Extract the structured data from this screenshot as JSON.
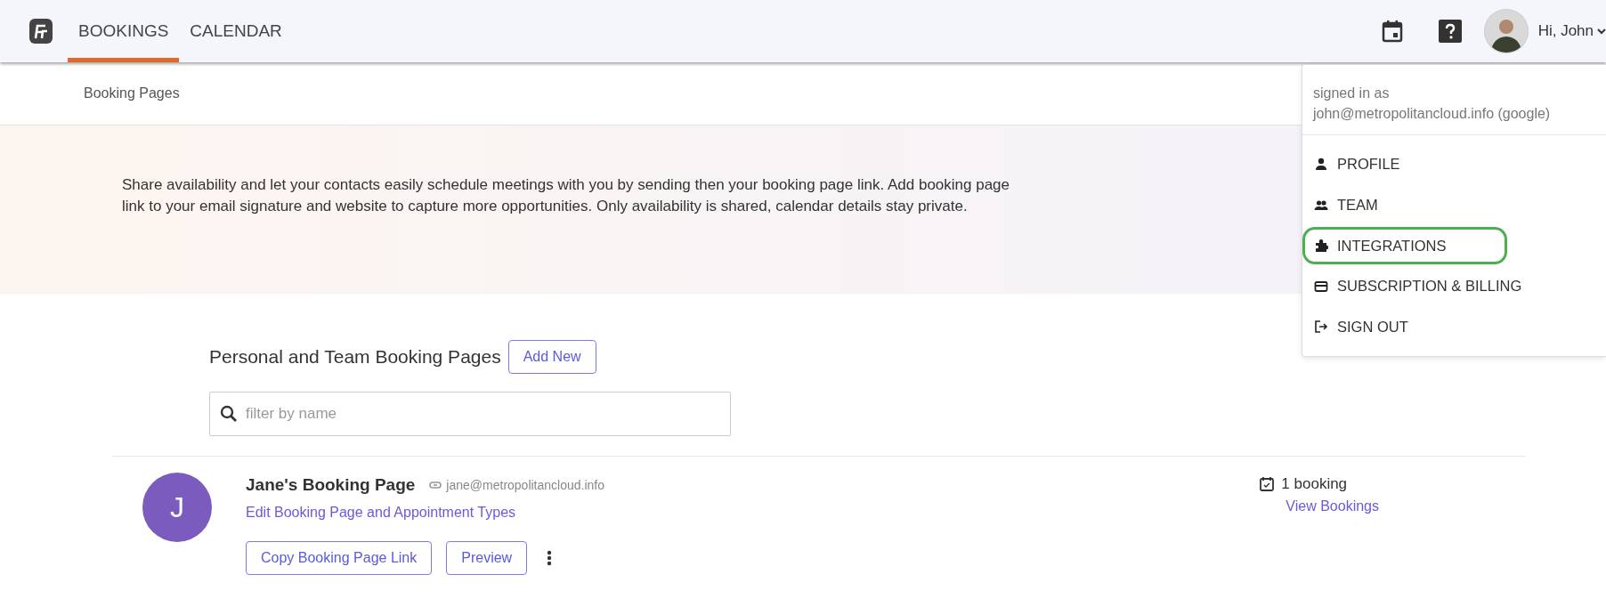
{
  "nav": {
    "tabs": [
      {
        "label": "BOOKINGS",
        "selected": true
      },
      {
        "label": "CALENDAR",
        "selected": false
      }
    ],
    "greeting": "Hi, John"
  },
  "breadcrumb": "Booking Pages",
  "banner": {
    "text": "Share availability and let your contacts easily schedule meetings with you by sending then your booking page link. Add booking page link to your email signature and website to capture more opportunities. Only availability is shared, calendar details stay private."
  },
  "section": {
    "title": "Personal and Team Booking Pages",
    "add_button": "Add New",
    "search": {
      "placeholder": "filter by name"
    }
  },
  "booking_pages": [
    {
      "initial": "J",
      "title": "Jane's Booking Page",
      "email": "jane@metropolitancloud.info",
      "edit_link": "Edit Booking Page and Appointment Types",
      "buttons": [
        "Copy Booking Page Link",
        "Preview"
      ],
      "bookings_count": "1 booking",
      "view_link": "View Bookings"
    }
  ],
  "user_menu": {
    "expanded": true,
    "signed_in_label": "signed in as",
    "account": "john@metropolitancloud.info (google)",
    "items": [
      {
        "label": "PROFILE",
        "kind": "profile",
        "highlighted": false
      },
      {
        "label": "TEAM",
        "kind": "team",
        "highlighted": false
      },
      {
        "label": "INTEGRATIONS",
        "kind": "integrations",
        "highlighted": true
      },
      {
        "label": "SUBSCRIPTION & BILLING",
        "kind": "billing",
        "highlighted": false
      },
      {
        "label": "SIGN OUT",
        "kind": "signout",
        "highlighted": false
      }
    ]
  }
}
